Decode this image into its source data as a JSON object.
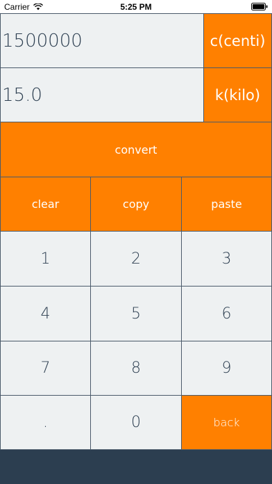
{
  "status_bar": {
    "carrier": "Carrier",
    "time": "5:25 PM"
  },
  "converter": {
    "input_value": "1500000",
    "input_unit": "c(centi)",
    "output_value": "15.0",
    "output_unit": "k(kilo)"
  },
  "actions": {
    "convert": "convert",
    "clear": "clear",
    "copy": "copy",
    "paste": "paste"
  },
  "keypad": {
    "k1": "1",
    "k2": "2",
    "k3": "3",
    "k4": "4",
    "k5": "5",
    "k6": "6",
    "k7": "7",
    "k8": "8",
    "k9": "9",
    "dot": ".",
    "k0": "0",
    "back": "back"
  },
  "colors": {
    "accent": "#ff8000",
    "key_bg": "#eef1f2",
    "dark": "#2c3e50"
  }
}
